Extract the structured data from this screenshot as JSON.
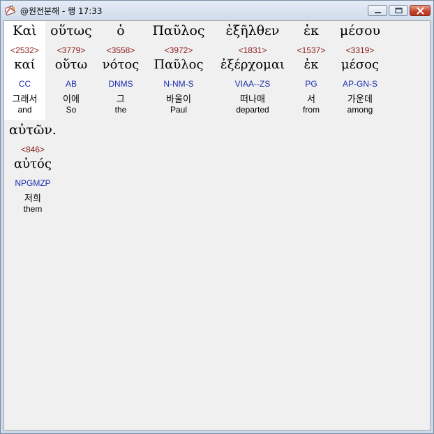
{
  "window": {
    "title": "@원전분해 - 행 17:33"
  },
  "passage": {
    "words": [
      {
        "greek": "Καὶ",
        "strong": "<2532>",
        "lemma": "καί",
        "parse": "CC",
        "korean": "그래서",
        "english": "and"
      },
      {
        "greek": "οὕτως",
        "strong": "<3779>",
        "lemma": "οὕτω",
        "parse": "AB",
        "korean": "이에",
        "english": "So"
      },
      {
        "greek": "ὁ",
        "strong": "<3558>",
        "lemma": "νότος",
        "parse": "DNMS",
        "korean": "그",
        "english": "the"
      },
      {
        "greek": "Παῦλος",
        "strong": "<3972>",
        "lemma": "Παῦλος",
        "parse": "N-NM-S",
        "korean": "바울이",
        "english": "Paul"
      },
      {
        "greek": "ἐξῆλθεν",
        "strong": "<1831>",
        "lemma": "ἐξέρχομαι",
        "parse": "VIAA--ZS",
        "korean": "떠나매",
        "english": "departed"
      },
      {
        "greek": "ἐκ",
        "strong": "<1537>",
        "lemma": "ἐκ",
        "parse": "PG",
        "korean": "서",
        "english": "from"
      },
      {
        "greek": "μέσου",
        "strong": "<3319>",
        "lemma": "μέσος",
        "parse": "AP-GN-S",
        "korean": "가운데",
        "english": "among"
      },
      {
        "greek": "αὐτῶν.",
        "strong": "<846>",
        "lemma": "αὐτός",
        "parse": "NPGMZP",
        "korean": "저희",
        "english": "them"
      }
    ]
  }
}
